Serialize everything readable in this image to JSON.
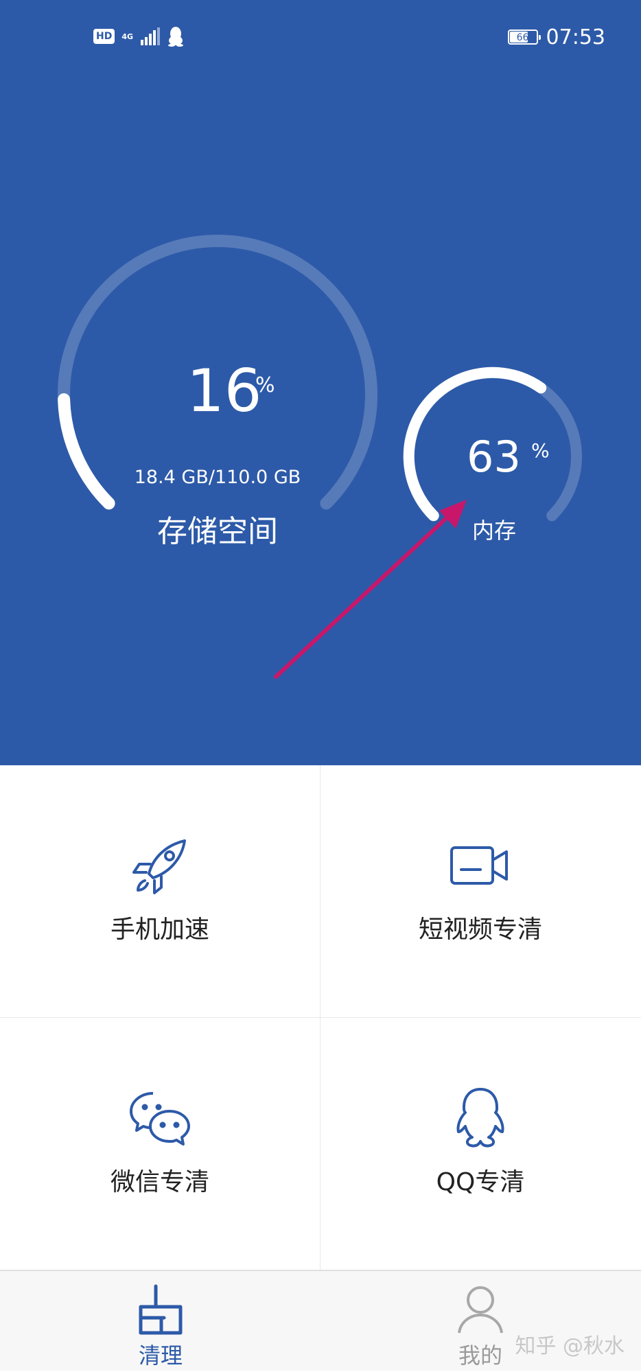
{
  "status_bar": {
    "hd_badge": "HD",
    "network": "4G",
    "battery_level": "66",
    "time": "07:53"
  },
  "storage": {
    "percent": "16",
    "percent_sign": "%",
    "detail": "18.4 GB/110.0 GB",
    "label": "存储空间",
    "fill_fraction": 0.16
  },
  "memory": {
    "percent": "63",
    "percent_sign": "%",
    "label": "内存",
    "fill_fraction": 0.63
  },
  "features": [
    {
      "label": "手机加速",
      "icon": "rocket-icon"
    },
    {
      "label": "短视频专清",
      "icon": "video-camera-icon"
    },
    {
      "label": "微信专清",
      "icon": "wechat-icon"
    },
    {
      "label": "QQ专清",
      "icon": "qq-penguin-icon"
    }
  ],
  "nav": {
    "clean_label": "清理",
    "mine_label": "我的"
  },
  "watermark": "知乎 @秋水",
  "colors": {
    "primary": "#2d5aa8",
    "annotation_arrow": "#c8176a"
  }
}
